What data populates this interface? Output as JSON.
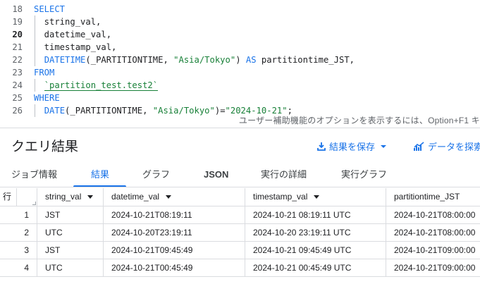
{
  "editor": {
    "lines": [
      {
        "num": "18",
        "bold": false,
        "parts": [
          {
            "t": "SELECT",
            "c": "kw"
          }
        ]
      },
      {
        "num": "19",
        "bold": false,
        "guide": true,
        "parts": [
          {
            "t": "  string_val,",
            "c": ""
          }
        ]
      },
      {
        "num": "20",
        "bold": true,
        "guide": true,
        "parts": [
          {
            "t": "  datetime_val,",
            "c": ""
          }
        ]
      },
      {
        "num": "21",
        "bold": false,
        "guide": true,
        "parts": [
          {
            "t": "  timestamp_val,",
            "c": ""
          }
        ]
      },
      {
        "num": "22",
        "bold": false,
        "guide": true,
        "parts": [
          {
            "t": "  ",
            "c": ""
          },
          {
            "t": "DATETIME",
            "c": "kw"
          },
          {
            "t": "(_PARTITIONTIME, ",
            "c": ""
          },
          {
            "t": "\"Asia/Tokyo\"",
            "c": "str"
          },
          {
            "t": ") ",
            "c": ""
          },
          {
            "t": "AS",
            "c": "kw"
          },
          {
            "t": " partitiontime_JST,",
            "c": ""
          }
        ]
      },
      {
        "num": "23",
        "bold": false,
        "parts": [
          {
            "t": "FROM",
            "c": "kw"
          }
        ]
      },
      {
        "num": "24",
        "bold": false,
        "guide": true,
        "parts": [
          {
            "t": "  ",
            "c": ""
          },
          {
            "t": "`partition_test.test2`",
            "c": "tbl"
          }
        ]
      },
      {
        "num": "25",
        "bold": false,
        "parts": [
          {
            "t": "WHERE",
            "c": "kw"
          }
        ]
      },
      {
        "num": "26",
        "bold": false,
        "guide": true,
        "parts": [
          {
            "t": "  ",
            "c": ""
          },
          {
            "t": "DATE",
            "c": "kw"
          },
          {
            "t": "(_PARTITIONTIME, ",
            "c": ""
          },
          {
            "t": "\"Asia/Tokyo\"",
            "c": "str"
          },
          {
            "t": ")=",
            "c": ""
          },
          {
            "t": "\"2024-10-21\"",
            "c": "str"
          },
          {
            "t": ";",
            "c": ""
          }
        ]
      }
    ],
    "accessibility_hint": "ユーザー補助機能のオプションを表示するには、Option+F1 キ"
  },
  "results": {
    "title": "クエリ結果",
    "save_results_label": "結果を保存",
    "explore_data_label": "データを探索"
  },
  "tabs": [
    {
      "label": "ジョブ情報",
      "active": false
    },
    {
      "label": "結果",
      "active": true
    },
    {
      "label": "グラフ",
      "active": false
    },
    {
      "label": "JSON",
      "active": false
    },
    {
      "label": "実行の詳細",
      "active": false
    },
    {
      "label": "実行グラフ",
      "active": false
    }
  ],
  "table": {
    "row_header": "行",
    "columns": [
      "string_val",
      "datetime_val",
      "timestamp_val",
      "partitiontime_JST"
    ],
    "rows": [
      {
        "n": "1",
        "cells": [
          "JST",
          "2024-10-21T08:19:11",
          "2024-10-21 08:19:11 UTC",
          "2024-10-21T08:00:00"
        ]
      },
      {
        "n": "2",
        "cells": [
          "UTC",
          "2024-10-20T23:19:11",
          "2024-10-20 23:19:11 UTC",
          "2024-10-21T08:00:00"
        ]
      },
      {
        "n": "3",
        "cells": [
          "JST",
          "2024-10-21T09:45:49",
          "2024-10-21 09:45:49 UTC",
          "2024-10-21T09:00:00"
        ]
      },
      {
        "n": "4",
        "cells": [
          "UTC",
          "2024-10-21T00:45:49",
          "2024-10-21 00:45:49 UTC",
          "2024-10-21T09:00:00"
        ]
      }
    ]
  },
  "colors": {
    "accent": "#1a73e8",
    "string": "#188038",
    "border": "#dadce0"
  }
}
